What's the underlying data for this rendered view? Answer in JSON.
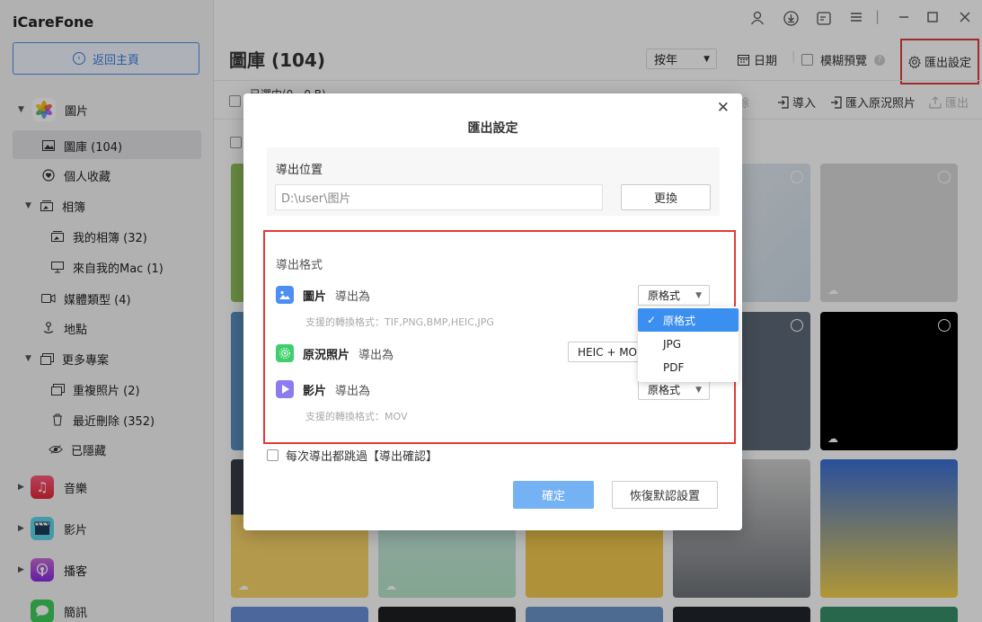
{
  "app": {
    "title": "iCareFone",
    "back_label": "返回主頁"
  },
  "sidebar": {
    "photos": "圖片",
    "library": "圖庫 (104)",
    "favorites": "個人收藏",
    "albums": "相簿",
    "my_albums": "我的相簿 (32)",
    "from_mac": "來自我的Mac (1)",
    "media_types": "媒體類型 (4)",
    "places": "地點",
    "more_projects": "更多專案",
    "duplicates": "重複照片 (2)",
    "recently_deleted": "最近刪除 (352)",
    "hidden": "已隱藏",
    "music": "音樂",
    "videos": "影片",
    "podcasts": "播客",
    "messages": "簡訊"
  },
  "header": {
    "title": "圖庫 (104)",
    "year_select": "按年",
    "date_label": "日期",
    "blur_preview": "模糊預覽",
    "export_settings": "匯出設定"
  },
  "actions": {
    "selected": "已選中(0，0 B)",
    "delete": "刪除",
    "import": "導入",
    "import_live": "匯入原況照片",
    "export": "匯出"
  },
  "dialog": {
    "title": "匯出設定",
    "location_label": "導出位置",
    "location_value": "D:\\user\\图片",
    "change_button": "更換",
    "format_label": "導出格式",
    "photo_name": "圖片",
    "export_as": "導出為",
    "photo_value": "原格式",
    "photo_hint": "支援的轉換格式：TIF,PNG,BMP,HEIC,JPG",
    "live_name": "原況照片",
    "live_value": "HEIC + MO",
    "video_name": "影片",
    "video_value": "原格式",
    "video_hint": "支援的轉換格式：MOV",
    "dropdown_options": [
      "原格式",
      "JPG",
      "PDF"
    ],
    "skip_confirm": "每次導出都跳過【導出確認】",
    "confirm_button": "確定",
    "reset_button": "恢復默認設置"
  },
  "colors": {
    "accent": "#3b8ff0",
    "highlight_border": "#e23b3b"
  }
}
